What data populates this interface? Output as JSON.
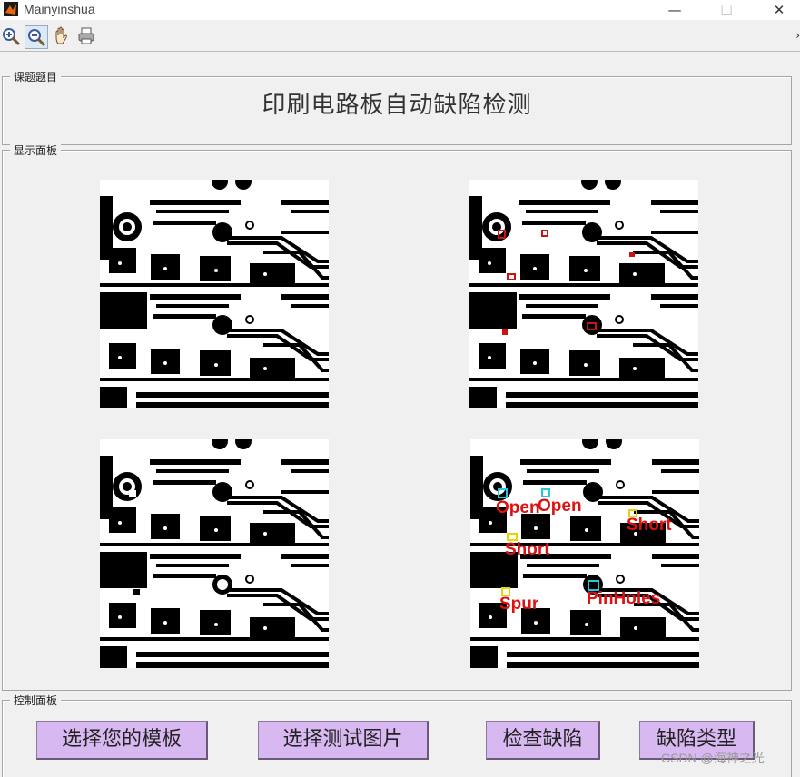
{
  "window": {
    "title": "Mainyinshua",
    "minimize": "—",
    "maximize": "☐",
    "close": "✕"
  },
  "toolbar": {
    "items": [
      {
        "name": "zoom-in",
        "icon": "zoom-in-icon"
      },
      {
        "name": "zoom-out",
        "icon": "zoom-out-icon"
      },
      {
        "name": "pan",
        "icon": "hand-icon"
      },
      {
        "name": "print",
        "icon": "printer-icon"
      }
    ],
    "chevron": "›"
  },
  "panels": {
    "title_panel": {
      "legend": "课题题目",
      "title": "印刷电路板自动缺陷检测"
    },
    "display_panel": {
      "legend": "显示面板"
    },
    "control_panel": {
      "legend": "控制面板"
    }
  },
  "buttons": {
    "select_template": "选择您的模板",
    "select_test": "选择测试图片",
    "detect_defects": "检查缺陷",
    "defect_types": "缺陷类型"
  },
  "defect_labels": {
    "open1": "Open",
    "open2": "Open",
    "short1": "Short",
    "short2": "Short",
    "spur": "Spur",
    "pinholes": "PinHoles"
  },
  "colors": {
    "defect_box": "#cc1111",
    "label_red": "#dd1111",
    "cyan_box": "#22c8dd",
    "yellow_box": "#e8d400",
    "button_bg": "#d8b8f0"
  },
  "watermark": "CSDN @海神之光"
}
